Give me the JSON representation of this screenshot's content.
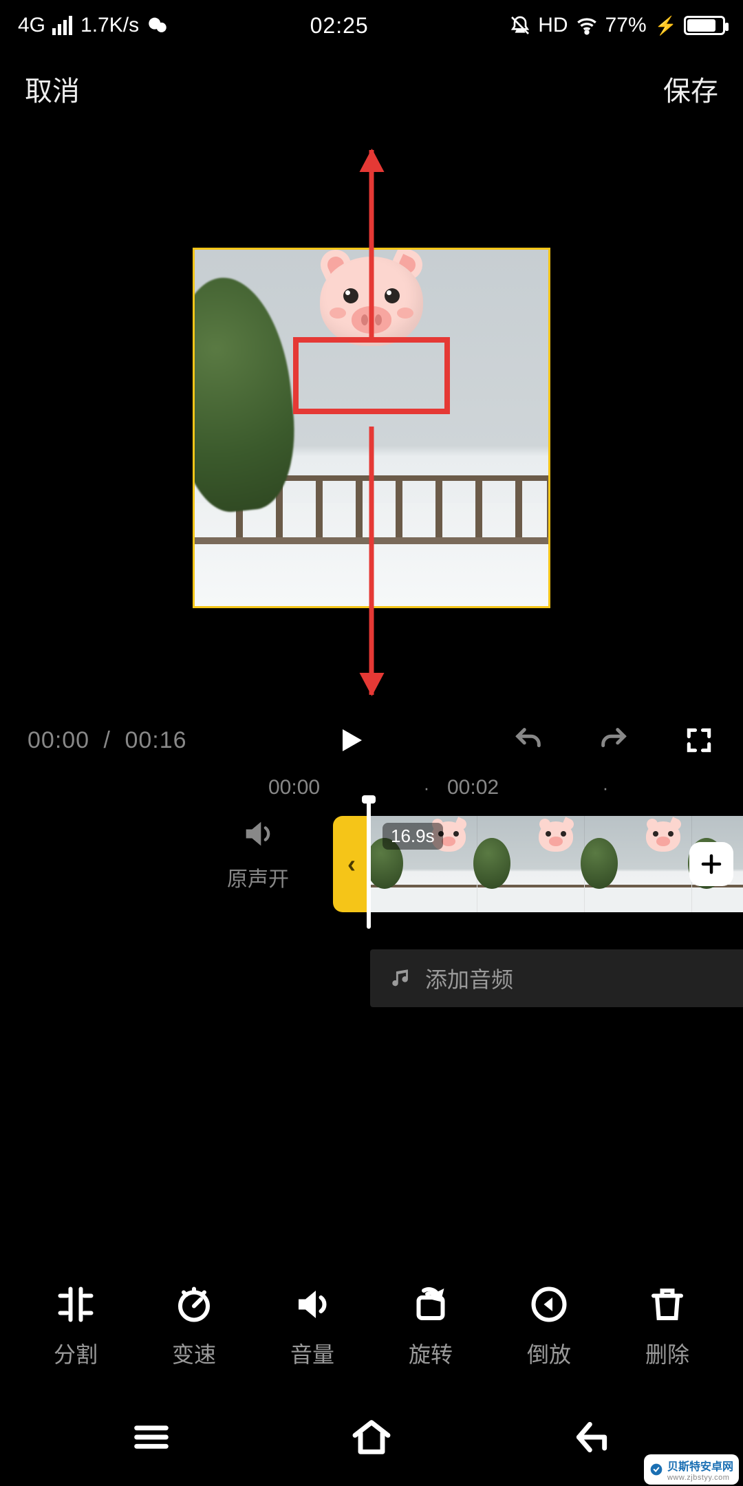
{
  "status": {
    "net": "4G",
    "speed": "1.7K/s",
    "time": "02:25",
    "hd": "HD",
    "battery": "77%"
  },
  "topbar": {
    "cancel": "取消",
    "save": "保存"
  },
  "playback": {
    "current": "00:00",
    "sep": "/",
    "total": "00:16"
  },
  "ruler": {
    "t0": "00:00",
    "t1": "00:02"
  },
  "timeline": {
    "sound_label": "原声开",
    "clip_duration": "16.9s",
    "add_audio": "添加音频",
    "handle_glyph": "‹"
  },
  "tools": [
    {
      "id": "split",
      "label": "分割"
    },
    {
      "id": "speed",
      "label": "变速"
    },
    {
      "id": "volume",
      "label": "音量"
    },
    {
      "id": "rotate",
      "label": "旋转"
    },
    {
      "id": "reverse",
      "label": "倒放"
    },
    {
      "id": "delete",
      "label": "删除"
    }
  ],
  "watermark": {
    "title": "贝斯特安卓网",
    "url": "www.zjbstyy.com"
  },
  "colors": {
    "accent": "#f5c518",
    "anno": "#e53935"
  }
}
